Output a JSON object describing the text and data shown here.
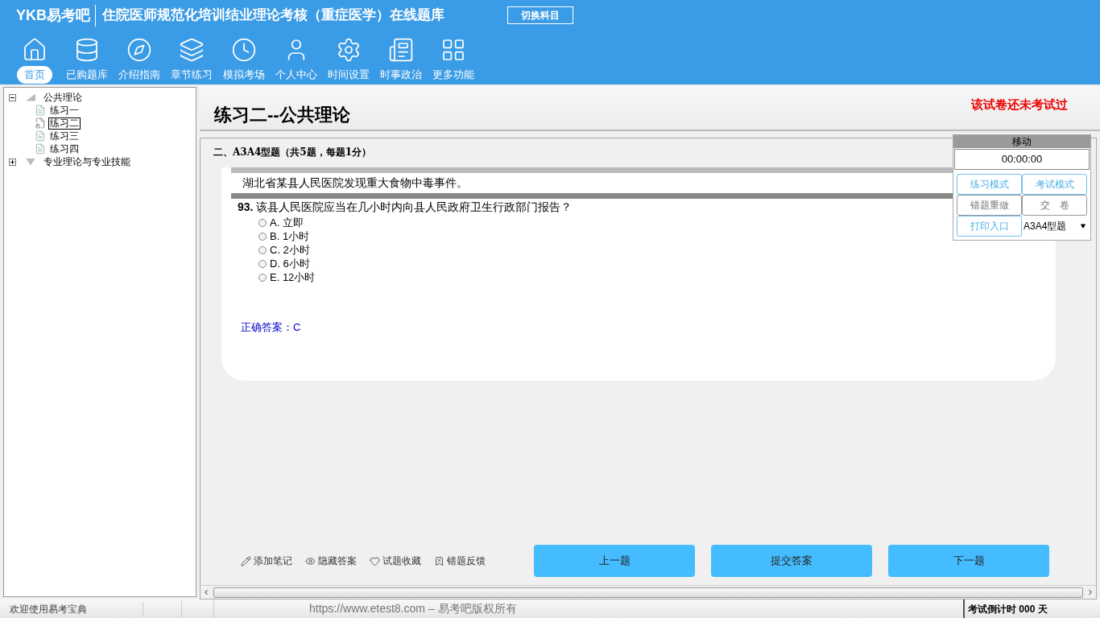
{
  "header": {
    "logo": "YKB易考吧",
    "title": "住院医师规范化培训结业理论考核（重症医学）在线题库",
    "switch_button": "切换科目"
  },
  "nav": [
    {
      "label": "首页",
      "selected": true
    },
    {
      "label": "已购题库",
      "selected": false
    },
    {
      "label": "介绍指南",
      "selected": false
    },
    {
      "label": "章节练习",
      "selected": false
    },
    {
      "label": "模拟考场",
      "selected": false
    },
    {
      "label": "个人中心",
      "selected": false
    },
    {
      "label": "时间设置",
      "selected": false
    },
    {
      "label": "时事政治",
      "selected": false
    },
    {
      "label": "更多功能",
      "selected": false
    }
  ],
  "tree": [
    {
      "label": "公共理论",
      "expanded": true,
      "children": [
        {
          "label": "练习一",
          "selected": false
        },
        {
          "label": "练习二",
          "selected": true
        },
        {
          "label": "练习三",
          "selected": false
        },
        {
          "label": "练习四",
          "selected": false
        }
      ]
    },
    {
      "label": "专业理论与专业技能",
      "expanded": false
    }
  ],
  "paper": {
    "title": "练习二--公共理论",
    "status": "该试卷还未考试过"
  },
  "section": "二、A3A4型题（共5题，每题1分）",
  "question": {
    "case": "湖北省某县人民医院发现重大食物中毒事件。",
    "number": "93.",
    "text": "该县人民医院应当在几小时内向县人民政府卫生行政部门报告？",
    "options": [
      {
        "label": "A. 立即",
        "selected": false
      },
      {
        "label": "B. 1小时",
        "selected": false
      },
      {
        "label": "C. 2小时",
        "selected": false
      },
      {
        "label": "D. 6小时",
        "selected": false
      },
      {
        "label": "E. 12小时",
        "selected": false
      }
    ],
    "answer": "正确答案：C"
  },
  "side_panel": {
    "handle": "移动",
    "timer": "00:00:00",
    "buttons": [
      {
        "label": "练习模式",
        "disabled": false
      },
      {
        "label": "考试模式",
        "disabled": false
      },
      {
        "label": "错题重做",
        "disabled": true
      },
      {
        "label": "交　卷",
        "disabled": true
      },
      {
        "label": "打印入口",
        "disabled": false
      }
    ],
    "type_select": "A3A4型题"
  },
  "tools": [
    "添加笔记",
    "隐藏答案",
    "试题收藏",
    "错题反馈"
  ],
  "nav_buttons": [
    "上一题",
    "提交答案",
    "下一题"
  ],
  "status_bar": {
    "welcome": "欢迎使用易考宝典",
    "copyright": "https://www.etest8.com – 易考吧版权所有",
    "countdown": "考试倒计时 000 天"
  }
}
